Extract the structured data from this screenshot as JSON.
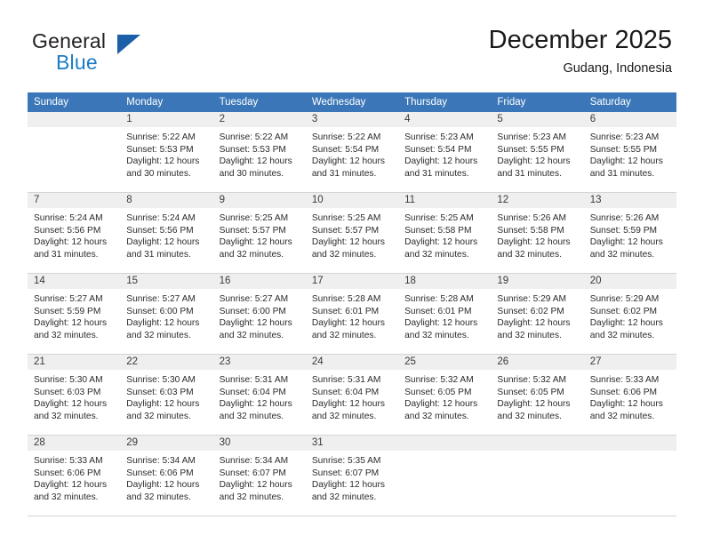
{
  "logo": {
    "word_one": "General",
    "word_two": "Blue",
    "triangle_color": "#1b5fa8",
    "blue_text_color": "#1d7dc4"
  },
  "header": {
    "title": "December 2025",
    "location": "Gudang, Indonesia"
  },
  "theme": {
    "header_row_background": "#3b77b8",
    "header_row_text": "#ffffff",
    "daynum_band_background": "#efefef",
    "cell_background": "#ffffff",
    "grid_line": "#d4d4d4"
  },
  "weekday_headers": [
    "Sunday",
    "Monday",
    "Tuesday",
    "Wednesday",
    "Thursday",
    "Friday",
    "Saturday"
  ],
  "weeks": [
    [
      {
        "day": "",
        "lines": [
          "",
          "",
          "",
          ""
        ]
      },
      {
        "day": "1",
        "lines": [
          "Sunrise: 5:22 AM",
          "Sunset: 5:53 PM",
          "Daylight: 12 hours",
          "and 30 minutes."
        ]
      },
      {
        "day": "2",
        "lines": [
          "Sunrise: 5:22 AM",
          "Sunset: 5:53 PM",
          "Daylight: 12 hours",
          "and 30 minutes."
        ]
      },
      {
        "day": "3",
        "lines": [
          "Sunrise: 5:22 AM",
          "Sunset: 5:54 PM",
          "Daylight: 12 hours",
          "and 31 minutes."
        ]
      },
      {
        "day": "4",
        "lines": [
          "Sunrise: 5:23 AM",
          "Sunset: 5:54 PM",
          "Daylight: 12 hours",
          "and 31 minutes."
        ]
      },
      {
        "day": "5",
        "lines": [
          "Sunrise: 5:23 AM",
          "Sunset: 5:55 PM",
          "Daylight: 12 hours",
          "and 31 minutes."
        ]
      },
      {
        "day": "6",
        "lines": [
          "Sunrise: 5:23 AM",
          "Sunset: 5:55 PM",
          "Daylight: 12 hours",
          "and 31 minutes."
        ]
      }
    ],
    [
      {
        "day": "7",
        "lines": [
          "Sunrise: 5:24 AM",
          "Sunset: 5:56 PM",
          "Daylight: 12 hours",
          "and 31 minutes."
        ]
      },
      {
        "day": "8",
        "lines": [
          "Sunrise: 5:24 AM",
          "Sunset: 5:56 PM",
          "Daylight: 12 hours",
          "and 31 minutes."
        ]
      },
      {
        "day": "9",
        "lines": [
          "Sunrise: 5:25 AM",
          "Sunset: 5:57 PM",
          "Daylight: 12 hours",
          "and 32 minutes."
        ]
      },
      {
        "day": "10",
        "lines": [
          "Sunrise: 5:25 AM",
          "Sunset: 5:57 PM",
          "Daylight: 12 hours",
          "and 32 minutes."
        ]
      },
      {
        "day": "11",
        "lines": [
          "Sunrise: 5:25 AM",
          "Sunset: 5:58 PM",
          "Daylight: 12 hours",
          "and 32 minutes."
        ]
      },
      {
        "day": "12",
        "lines": [
          "Sunrise: 5:26 AM",
          "Sunset: 5:58 PM",
          "Daylight: 12 hours",
          "and 32 minutes."
        ]
      },
      {
        "day": "13",
        "lines": [
          "Sunrise: 5:26 AM",
          "Sunset: 5:59 PM",
          "Daylight: 12 hours",
          "and 32 minutes."
        ]
      }
    ],
    [
      {
        "day": "14",
        "lines": [
          "Sunrise: 5:27 AM",
          "Sunset: 5:59 PM",
          "Daylight: 12 hours",
          "and 32 minutes."
        ]
      },
      {
        "day": "15",
        "lines": [
          "Sunrise: 5:27 AM",
          "Sunset: 6:00 PM",
          "Daylight: 12 hours",
          "and 32 minutes."
        ]
      },
      {
        "day": "16",
        "lines": [
          "Sunrise: 5:27 AM",
          "Sunset: 6:00 PM",
          "Daylight: 12 hours",
          "and 32 minutes."
        ]
      },
      {
        "day": "17",
        "lines": [
          "Sunrise: 5:28 AM",
          "Sunset: 6:01 PM",
          "Daylight: 12 hours",
          "and 32 minutes."
        ]
      },
      {
        "day": "18",
        "lines": [
          "Sunrise: 5:28 AM",
          "Sunset: 6:01 PM",
          "Daylight: 12 hours",
          "and 32 minutes."
        ]
      },
      {
        "day": "19",
        "lines": [
          "Sunrise: 5:29 AM",
          "Sunset: 6:02 PM",
          "Daylight: 12 hours",
          "and 32 minutes."
        ]
      },
      {
        "day": "20",
        "lines": [
          "Sunrise: 5:29 AM",
          "Sunset: 6:02 PM",
          "Daylight: 12 hours",
          "and 32 minutes."
        ]
      }
    ],
    [
      {
        "day": "21",
        "lines": [
          "Sunrise: 5:30 AM",
          "Sunset: 6:03 PM",
          "Daylight: 12 hours",
          "and 32 minutes."
        ]
      },
      {
        "day": "22",
        "lines": [
          "Sunrise: 5:30 AM",
          "Sunset: 6:03 PM",
          "Daylight: 12 hours",
          "and 32 minutes."
        ]
      },
      {
        "day": "23",
        "lines": [
          "Sunrise: 5:31 AM",
          "Sunset: 6:04 PM",
          "Daylight: 12 hours",
          "and 32 minutes."
        ]
      },
      {
        "day": "24",
        "lines": [
          "Sunrise: 5:31 AM",
          "Sunset: 6:04 PM",
          "Daylight: 12 hours",
          "and 32 minutes."
        ]
      },
      {
        "day": "25",
        "lines": [
          "Sunrise: 5:32 AM",
          "Sunset: 6:05 PM",
          "Daylight: 12 hours",
          "and 32 minutes."
        ]
      },
      {
        "day": "26",
        "lines": [
          "Sunrise: 5:32 AM",
          "Sunset: 6:05 PM",
          "Daylight: 12 hours",
          "and 32 minutes."
        ]
      },
      {
        "day": "27",
        "lines": [
          "Sunrise: 5:33 AM",
          "Sunset: 6:06 PM",
          "Daylight: 12 hours",
          "and 32 minutes."
        ]
      }
    ],
    [
      {
        "day": "28",
        "lines": [
          "Sunrise: 5:33 AM",
          "Sunset: 6:06 PM",
          "Daylight: 12 hours",
          "and 32 minutes."
        ]
      },
      {
        "day": "29",
        "lines": [
          "Sunrise: 5:34 AM",
          "Sunset: 6:06 PM",
          "Daylight: 12 hours",
          "and 32 minutes."
        ]
      },
      {
        "day": "30",
        "lines": [
          "Sunrise: 5:34 AM",
          "Sunset: 6:07 PM",
          "Daylight: 12 hours",
          "and 32 minutes."
        ]
      },
      {
        "day": "31",
        "lines": [
          "Sunrise: 5:35 AM",
          "Sunset: 6:07 PM",
          "Daylight: 12 hours",
          "and 32 minutes."
        ]
      },
      {
        "day": "",
        "lines": [
          "",
          "",
          "",
          ""
        ]
      },
      {
        "day": "",
        "lines": [
          "",
          "",
          "",
          ""
        ]
      },
      {
        "day": "",
        "lines": [
          "",
          "",
          "",
          ""
        ]
      }
    ]
  ]
}
